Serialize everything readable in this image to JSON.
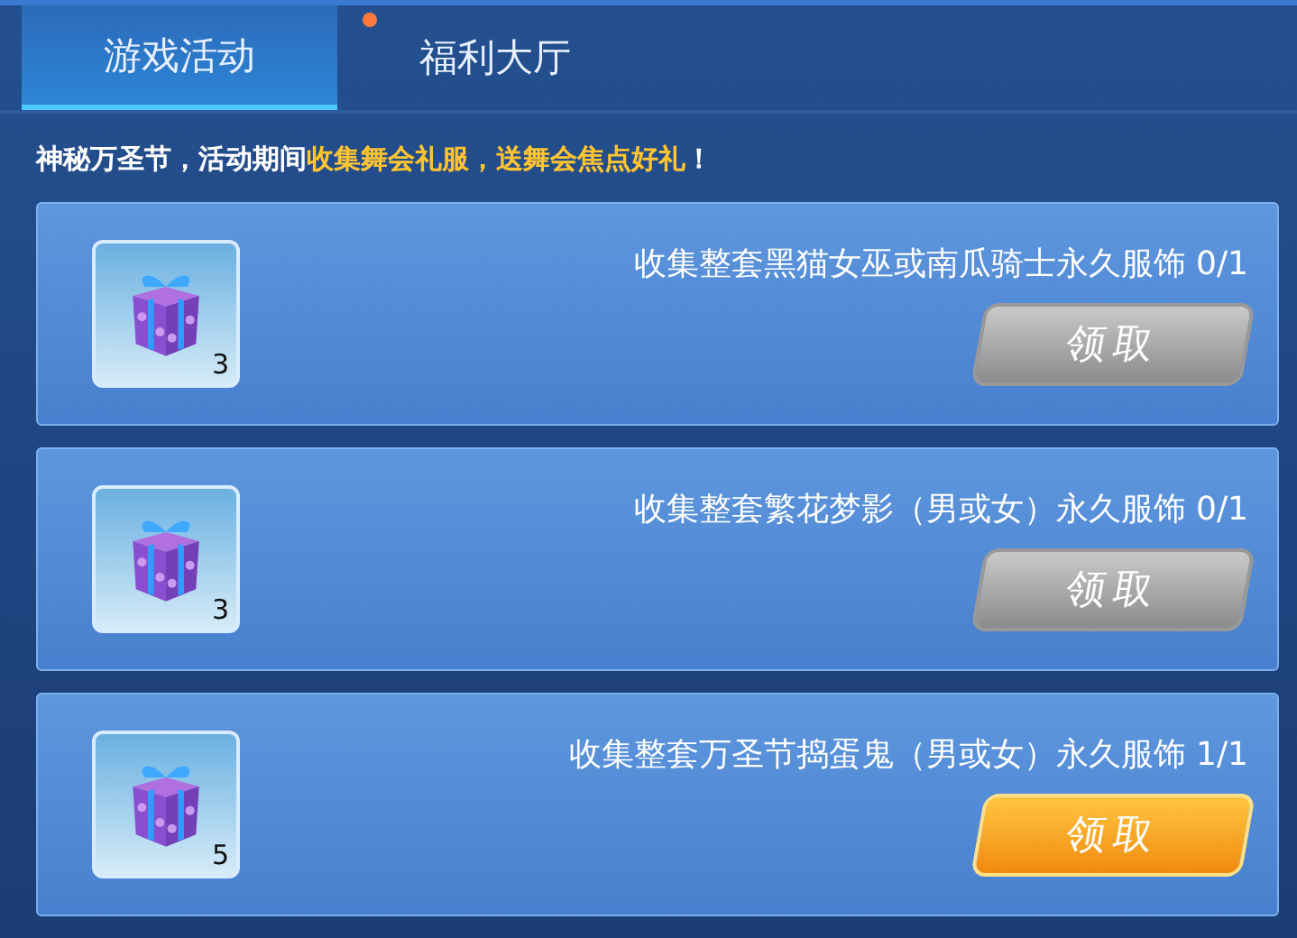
{
  "tabs": [
    {
      "label": "游戏活动",
      "selected": true,
      "dot": false
    },
    {
      "label": "福利大厅",
      "selected": false,
      "dot": true
    }
  ],
  "banner": "神秘万圣节，活动期间**收集舞会礼服，送舞会焦点好礼**！",
  "tasks": [
    {
      "count": "3",
      "title": "收集整套黑猫女巫或南瓜骑士永久服饰 0/1",
      "button": "领取",
      "enabled": false
    },
    {
      "count": "3",
      "title": "收集整套繁花梦影（男或女）永久服饰 0/1",
      "button": "领取",
      "enabled": false
    },
    {
      "count": "5",
      "title": "收集整套万圣节捣蛋鬼（男或女）永久服饰 1/1",
      "button": "领取",
      "enabled": true
    }
  ]
}
